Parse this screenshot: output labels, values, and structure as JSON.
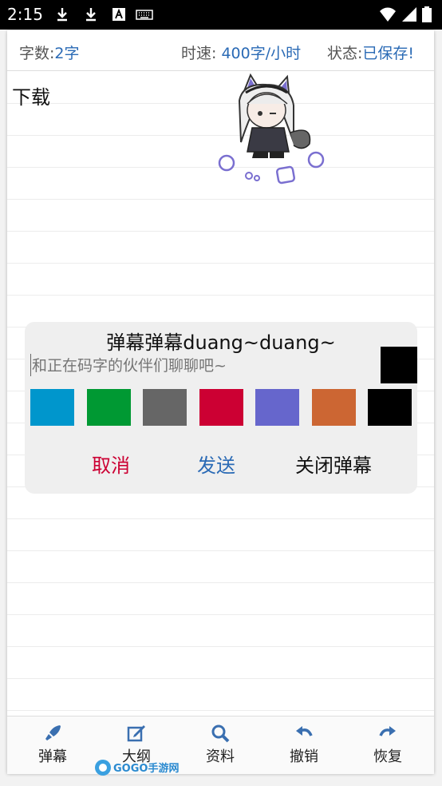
{
  "status_bar": {
    "time": "2:15",
    "icons": [
      "download-icon",
      "download-icon",
      "text-a-icon",
      "keyboard-icon",
      "wifi-icon",
      "signal-icon",
      "battery-icon"
    ]
  },
  "topbar": {
    "word_count_label": "字数:",
    "word_count_value": "2字",
    "speed_label": "时速:",
    "speed_value": "400字/小时",
    "status_label": "状态:",
    "status_value": "已保存!"
  },
  "document": {
    "text": "下载"
  },
  "danmaku_dialog": {
    "title": "弹幕弹幕duang~duang~",
    "input_placeholder": "和正在码字的伙伴们聊聊吧~",
    "selected_color": "#000000",
    "colors": [
      "#0096cc",
      "#009933",
      "#666666",
      "#cc0033",
      "#6666cc",
      "#cc6633",
      "#000000"
    ],
    "cancel_label": "取消",
    "cancel_color": "#cc0033",
    "send_label": "发送",
    "send_color": "#2a6ab5",
    "close_label": "关闭弹幕"
  },
  "bottom_nav": {
    "items": [
      {
        "label": "弹幕",
        "icon": "rocket-icon"
      },
      {
        "label": "大纲",
        "icon": "edit-icon"
      },
      {
        "label": "资料",
        "icon": "search-icon"
      },
      {
        "label": "撤销",
        "icon": "undo-icon"
      },
      {
        "label": "恢复",
        "icon": "redo-icon"
      }
    ],
    "icon_color": "#3a6fb0"
  },
  "watermark": {
    "text": "GOGO手游网"
  }
}
